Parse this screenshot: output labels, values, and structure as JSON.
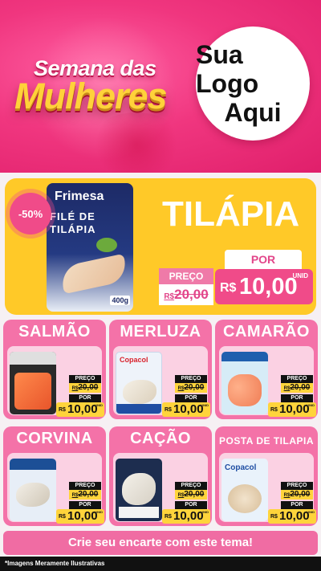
{
  "header": {
    "title_top": "Semana das",
    "title_main": "Mulheres",
    "logo_line1": "Sua Logo",
    "logo_line2": "Aqui"
  },
  "featured": {
    "discount_badge": "-50%",
    "brand": "Frimesa",
    "package_line1": "FILÉ DE",
    "package_line2": "TILÁPIA",
    "package_weight": "400g",
    "name": "TILÁPIA",
    "old_label": "PREÇO",
    "old_currency": "R$",
    "old_price": "20,00",
    "new_label": "POR",
    "new_currency": "R$",
    "new_price": "10,00",
    "unit": "UNID"
  },
  "products": [
    {
      "name": "SALMÃO",
      "old_label": "PREÇO",
      "old_currency": "R$",
      "old_price": "20,00",
      "new_label": "POR",
      "new_currency": "R$",
      "new_price": "10,00",
      "unit": "UNID"
    },
    {
      "name": "MERLUZA",
      "old_label": "PREÇO",
      "old_currency": "R$",
      "old_price": "20,00",
      "new_label": "POR",
      "new_currency": "R$",
      "new_price": "10,00",
      "unit": "UNID",
      "package_brand": "Copacol"
    },
    {
      "name": "CAMARÃO",
      "old_label": "PREÇO",
      "old_currency": "R$",
      "old_price": "20,00",
      "new_label": "POR",
      "new_currency": "R$",
      "new_price": "10,00",
      "unit": "UNID"
    },
    {
      "name": "CORVINA",
      "old_label": "PREÇO",
      "old_currency": "R$",
      "old_price": "20,00",
      "new_label": "POR",
      "new_currency": "R$",
      "new_price": "10,00",
      "unit": "UNID"
    },
    {
      "name": "CAÇÃO",
      "old_label": "PREÇO",
      "old_currency": "R$",
      "old_price": "20,00",
      "new_label": "POR",
      "new_currency": "R$",
      "new_price": "10,00",
      "unit": "UNID"
    },
    {
      "name": "POSTA DE TILAPIA",
      "old_label": "PREÇO",
      "old_currency": "R$",
      "old_price": "20,00",
      "new_label": "POR",
      "new_currency": "R$",
      "new_price": "10,00",
      "unit": "UNID",
      "package_brand": "Copacol"
    }
  ],
  "cta": "Crie seu encarte com este tema!",
  "footer_note": "*Imagens Meramente Ilustrativas",
  "colors": {
    "header_pink": "#f0367f",
    "feature_yellow": "#ffc928",
    "card_pink": "#f472a8",
    "price_yellow": "#ffd43b"
  }
}
